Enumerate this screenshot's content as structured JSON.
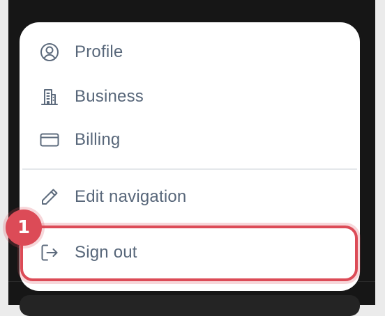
{
  "menu": {
    "items": [
      {
        "label": "Profile",
        "icon": "user-circle-icon"
      },
      {
        "label": "Business",
        "icon": "building-icon"
      },
      {
        "label": "Billing",
        "icon": "credit-card-icon"
      },
      {
        "label": "Edit navigation",
        "icon": "pencil-icon"
      },
      {
        "label": "Sign out",
        "icon": "sign-out-icon"
      }
    ]
  },
  "annotation": {
    "step": "1",
    "color": "#dc4b57"
  },
  "colors": {
    "label": "#58677a",
    "icon": "#5d6b7d",
    "menu_background": "#ffffff",
    "backdrop": "#161616"
  }
}
